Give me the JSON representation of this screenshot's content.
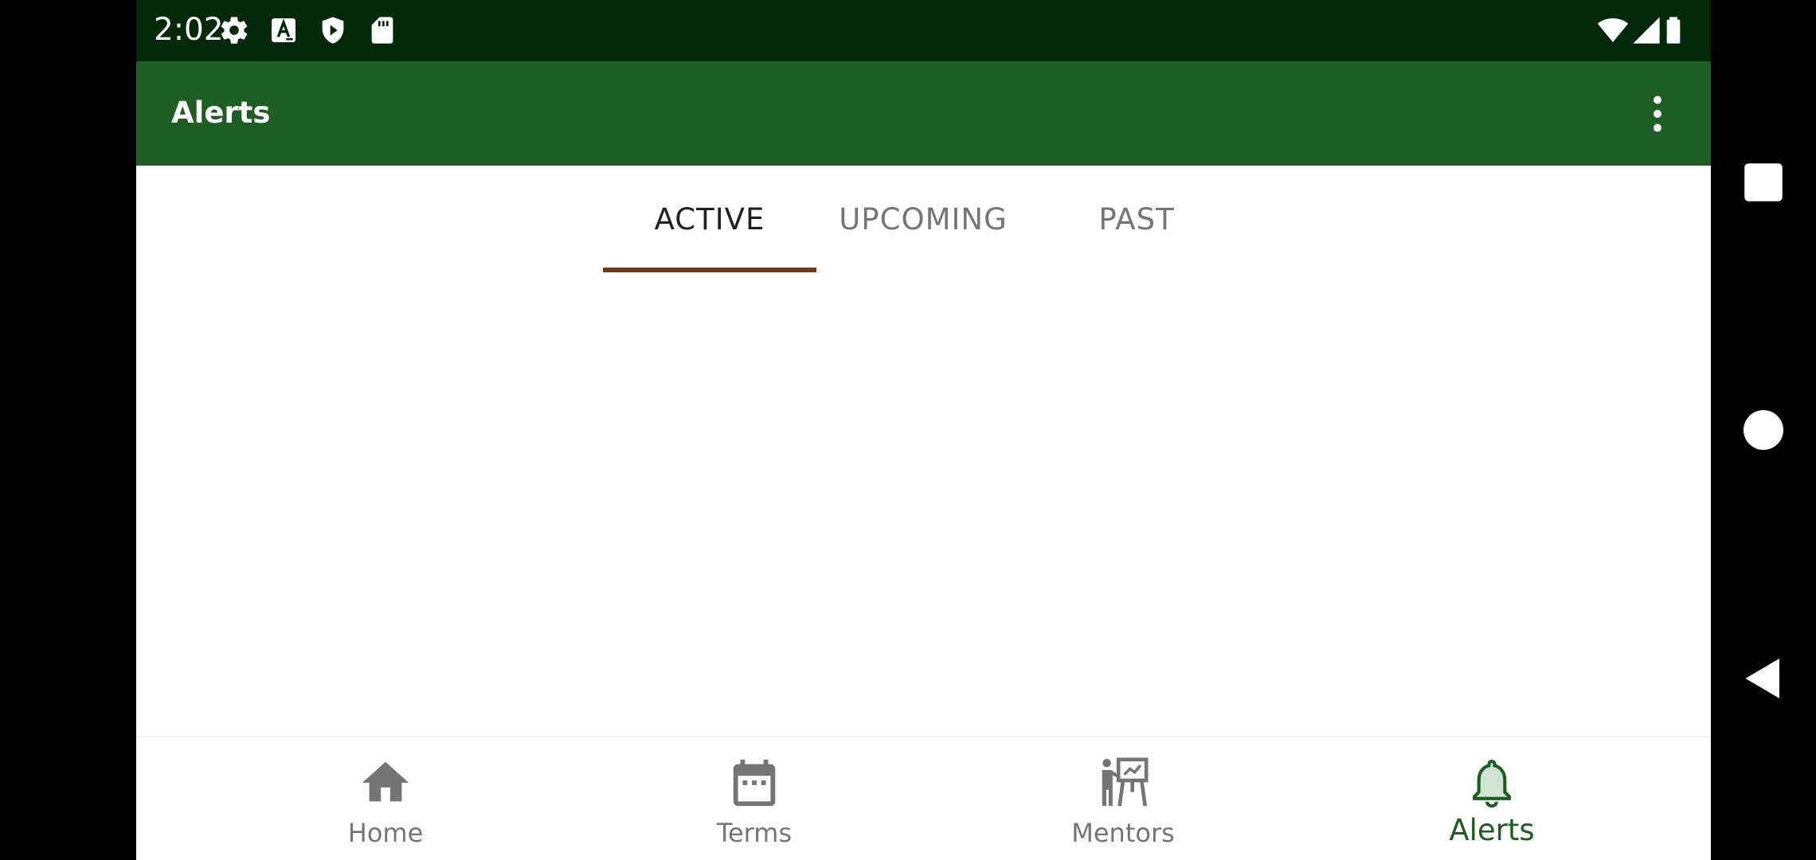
{
  "status_bar": {
    "time": "2:02",
    "left_icons": [
      "settings-icon",
      "font-a-icon",
      "shield-play-icon",
      "sd-card-icon"
    ],
    "right_icons": [
      "wifi-icon",
      "cell-signal-icon",
      "battery-icon"
    ],
    "background_color": "#022a08"
  },
  "toolbar": {
    "title": "Alerts",
    "overflow_icon": "more-vert-icon",
    "background_color": "#1e5e22"
  },
  "tabs": {
    "items": [
      {
        "label": "ACTIVE",
        "selected": true
      },
      {
        "label": "UPCOMING",
        "selected": false
      },
      {
        "label": "PAST",
        "selected": false
      }
    ],
    "indicator_color": "#6d3a16"
  },
  "bottom_nav": {
    "items": [
      {
        "label": "Home",
        "icon": "home-icon",
        "selected": false
      },
      {
        "label": "Terms",
        "icon": "calendar-icon",
        "selected": false
      },
      {
        "label": "Mentors",
        "icon": "presenter-icon",
        "selected": false
      },
      {
        "label": "Alerts",
        "icon": "bell-icon",
        "selected": true
      }
    ],
    "selected_color": "#1b5e20",
    "unselected_color": "#757575"
  },
  "system_nav": {
    "buttons": [
      "recents-icon",
      "home-circle-icon",
      "back-icon"
    ]
  }
}
